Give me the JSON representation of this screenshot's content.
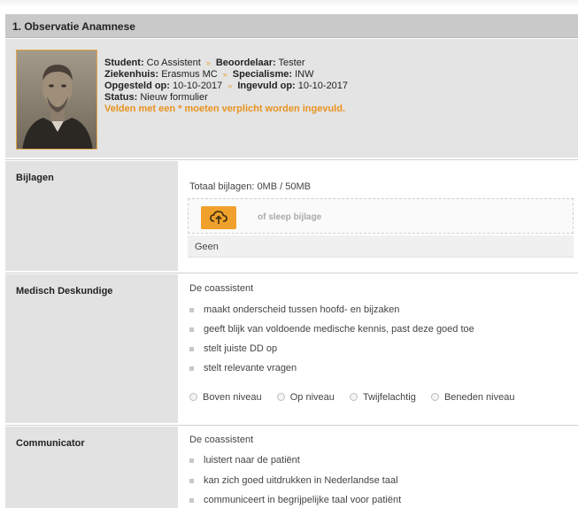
{
  "section": {
    "title": "1. Observatie Anamnese"
  },
  "info": {
    "student_label": "Student:",
    "student_value": "Co Assistent",
    "assessor_label": "Beoordelaar:",
    "assessor_value": "Tester",
    "hospital_label": "Ziekenhuis:",
    "hospital_value": "Erasmus MC",
    "specialism_label": "Specialisme:",
    "specialism_value": "INW",
    "created_label": "Opgesteld op:",
    "created_value": "10-10-2017",
    "filled_label": "Ingevuld op:",
    "filled_value": "10-10-2017",
    "status_label": "Status:",
    "status_value": "Nieuw formulier",
    "required_note": "Velden met een * moeten verplicht worden ingevuld."
  },
  "attachments": {
    "label": "Bijlagen",
    "total": "Totaal bijlagen: 0MB / 50MB",
    "drop_text": "of sleep bijlage",
    "none": "Geen"
  },
  "medical": {
    "label": "Medisch Deskundige",
    "intro": "De coassistent",
    "items": [
      "maakt onderscheid tussen hoofd- en bijzaken",
      "geeft blijk van voldoende medische kennis, past deze goed toe",
      "stelt juiste DD op",
      "stelt relevante vragen"
    ],
    "options": [
      "Boven niveau",
      "Op niveau",
      "Twijfelachtig",
      "Beneden niveau"
    ]
  },
  "communicator": {
    "label": "Communicator",
    "intro": "De coassistent",
    "items": [
      "luistert naar de patiënt",
      "kan zich goed uitdrukken in Nederlandse taal",
      "communiceert in begrijpelijke taal voor patiënt"
    ]
  }
}
